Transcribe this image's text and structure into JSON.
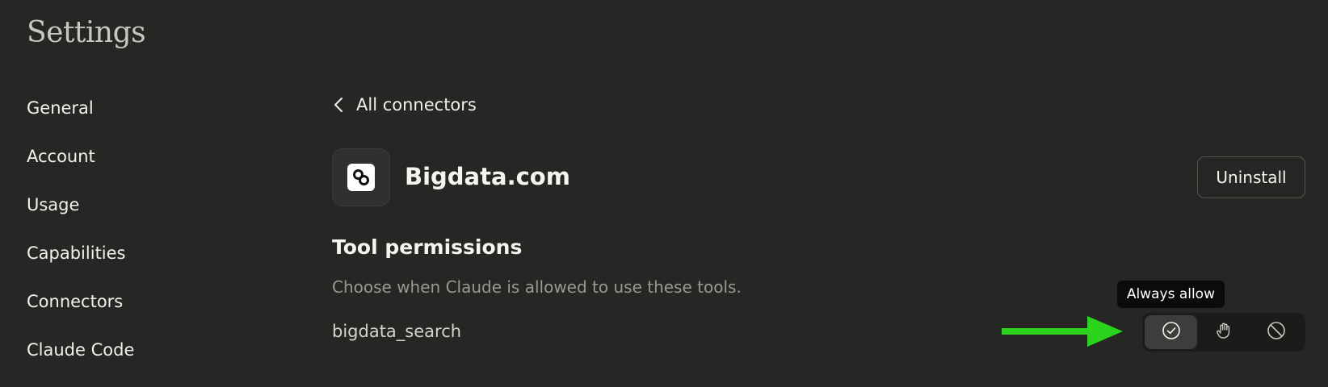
{
  "page": {
    "title": "Settings"
  },
  "sidebar": {
    "items": [
      {
        "label": "General"
      },
      {
        "label": "Account"
      },
      {
        "label": "Usage"
      },
      {
        "label": "Capabilities"
      },
      {
        "label": "Connectors"
      },
      {
        "label": "Claude Code"
      }
    ]
  },
  "main": {
    "back_label": "All connectors",
    "connector": {
      "name": "Bigdata.com",
      "logo_icon": "bigdata-logo-icon",
      "uninstall_label": "Uninstall"
    },
    "tool_permissions": {
      "title": "Tool permissions",
      "description": "Choose when Claude is allowed to use these tools.",
      "tools": [
        {
          "name": "bigdata_search",
          "selected": "always-allow",
          "options": [
            {
              "id": "always-allow",
              "icon": "check-circle-icon"
            },
            {
              "id": "needs-approval",
              "icon": "hand-icon"
            },
            {
              "id": "block",
              "icon": "block-icon"
            }
          ]
        }
      ],
      "tooltip": "Always allow"
    }
  },
  "colors": {
    "background": "#262625",
    "text": "#f5f4ef",
    "muted_text": "#9a988f",
    "annotation_arrow": "#2bd31c"
  }
}
